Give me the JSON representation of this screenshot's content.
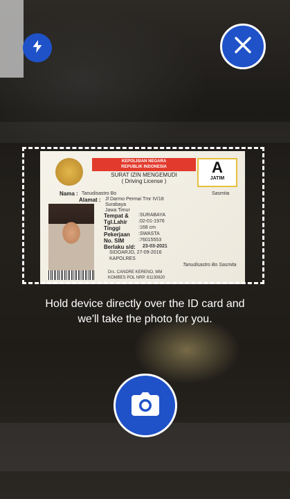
{
  "camera": {
    "flash_icon": "flash-icon",
    "close_icon": "close-icon",
    "shutter_icon": "camera-icon"
  },
  "instruction": {
    "line1": "Hold device directly over the ID card and",
    "line2": "we'll take the photo for you."
  },
  "id_card": {
    "agency_line1": "KEPOLISIAN NEGARA",
    "agency_line2": "REPUBLIK INDONESIA",
    "title_line1": "SURAT IZIN MENGEMUDI",
    "title_line2": "( Driving License )",
    "license_class": "A",
    "region": "JATIM",
    "name_label": "Nama :",
    "name_value": "Tanudisastro Bo",
    "name_extra": "Sasmita",
    "address_label": "Alamat :",
    "address_line1": "Jl Darmo Permai Tmr IV/18",
    "address_line2": "Surabaya",
    "address_line3": "Jawa Timur",
    "birth_label": "Tempat &",
    "birth_label2": "Tgl.Lahir",
    "birth_place": ":SURABAYA",
    "birth_date": ":02-01-1976",
    "height_label": "Tinggi",
    "height_value": ":168 cm",
    "job_label": "Pekerjaan",
    "job_value": ":SWASTA",
    "sim_label": "No. SIM",
    "sim_value": ":76015553",
    "valid_label": "Berlaku s/d:",
    "valid_value": "23-03-2021",
    "issued": "SIDOARJO, 27-09-2016",
    "official_title": "KAPOLRES",
    "official_name": "Drs. CANDRE KERENO, MM",
    "official_rank": "KOMBES POL NRP. 61130820",
    "holder_signature": "Tanudisastro Bo Sasmita"
  }
}
